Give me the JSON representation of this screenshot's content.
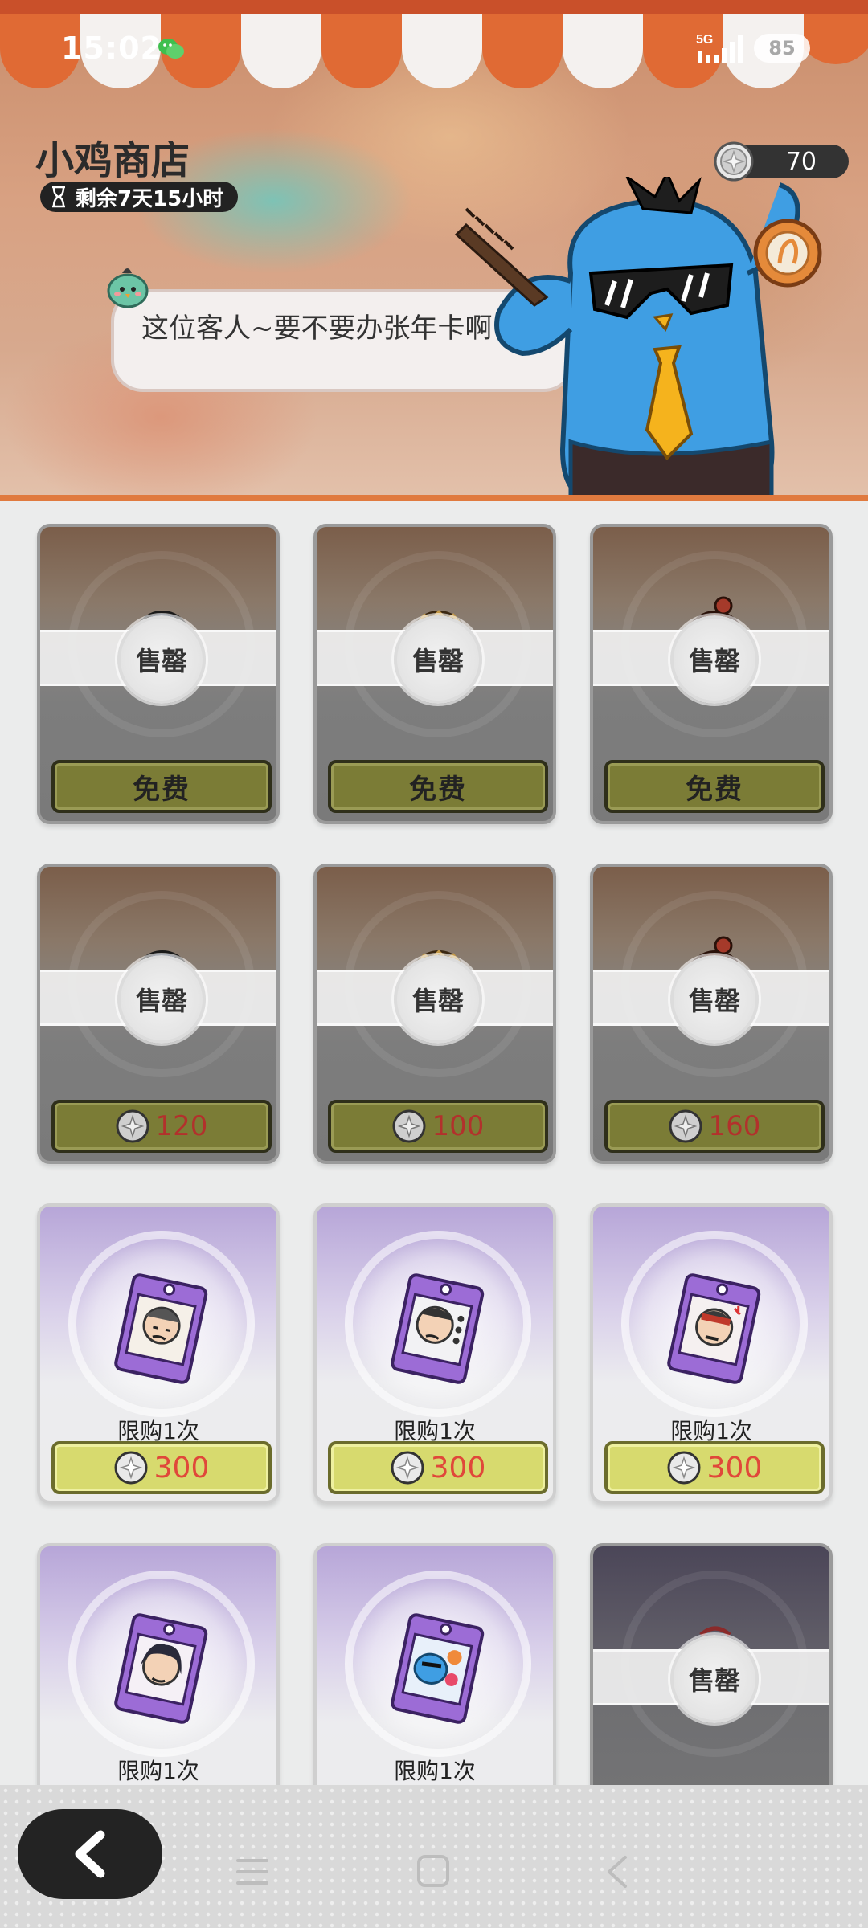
{
  "status_bar": {
    "time": "15:02",
    "network": "5G",
    "battery": "85",
    "icons": [
      "wechat-icon",
      "signal-icon"
    ]
  },
  "shop": {
    "title": "小鸡商店",
    "time_left": "剩余7天15小时",
    "coin_balance": "70",
    "npc_dialog": "这位客人~要不要办张年卡啊~"
  },
  "items": [
    {
      "state": "sold_out",
      "badge": "售罄",
      "price_label": "免费",
      "art": "round-frame-item"
    },
    {
      "state": "sold_out",
      "badge": "售罄",
      "price_label": "免费",
      "art": "gold-frame-item"
    },
    {
      "state": "sold_out",
      "badge": "售罄",
      "price_label": "免费",
      "art": "red-frame-item"
    },
    {
      "state": "sold_out",
      "badge": "售罄",
      "price": "120",
      "art": "round-frame-item"
    },
    {
      "state": "sold_out",
      "badge": "售罄",
      "price": "100",
      "art": "gold-frame-item"
    },
    {
      "state": "sold_out",
      "badge": "售罄",
      "price": "160",
      "art": "red-frame-item"
    },
    {
      "state": "available",
      "limit": "限购1次",
      "price": "300",
      "art": "sticker-pack-1"
    },
    {
      "state": "available",
      "limit": "限购1次",
      "price": "300",
      "art": "sticker-pack-2"
    },
    {
      "state": "available",
      "limit": "限购1次",
      "price": "300",
      "art": "sticker-pack-3"
    },
    {
      "state": "available",
      "limit": "限购1次",
      "art": "sticker-pack-4"
    },
    {
      "state": "available",
      "limit": "限购1次",
      "art": "sticker-pack-5"
    },
    {
      "state": "sold_out",
      "badge": "售罄",
      "art": "dark-frame-item"
    }
  ],
  "nav": {
    "back_icon": "chevron-left-icon",
    "system_icons": [
      "menu-icon",
      "home-icon",
      "back-icon"
    ]
  },
  "colors": {
    "awning_orange": "#e06a34",
    "price_red": "#e0483a",
    "sold_button": "#7b7c36",
    "buy_button": "#d7da6e"
  }
}
